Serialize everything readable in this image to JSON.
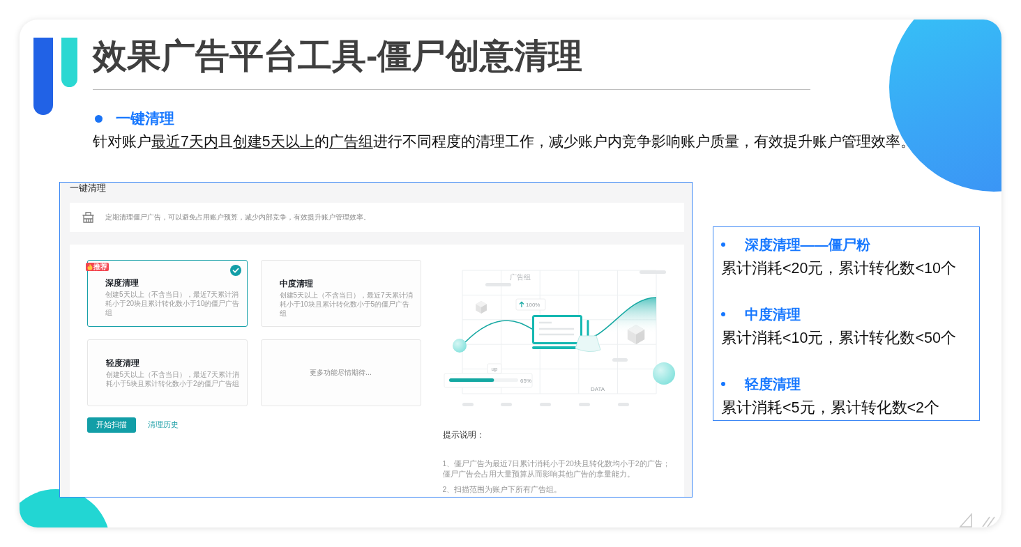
{
  "slide": {
    "title": "效果广告平台工具-僵尸创意清理"
  },
  "section": {
    "heading": "一键清理",
    "description": [
      {
        "text": "针对账户",
        "underlined": false
      },
      {
        "text": "最近7天内",
        "underlined": true
      },
      {
        "text": "且",
        "underlined": false
      },
      {
        "text": "创建5天以上",
        "underlined": true
      },
      {
        "text": "的",
        "underlined": false
      },
      {
        "text": "广告组",
        "underlined": true
      },
      {
        "text": "进行不同程度的清理工作，减少账户内竞争影响账户质量，有效提升账户管理效率。",
        "underlined": false
      }
    ]
  },
  "app": {
    "title": "一键清理",
    "notice": "定期清理僵尸广告，可以避免占用账户预算，减少内部竞争，有效提升账户管理效率。",
    "options": [
      {
        "kind": "mode",
        "title": "深度清理",
        "description": "创建5天以上（不含当日），最近7天累计消耗小于20块且累计转化数小于10的僵尸广告组",
        "badge": "推荐",
        "selected": true
      },
      {
        "kind": "mode",
        "title": "中度清理",
        "description": "创建5天以上（不含当日），最近7天累计消耗小于10块且累计转化数小于5的僵尸广告组",
        "selected": false
      },
      {
        "kind": "mode",
        "title": "轻度清理",
        "description": "创建5天以上（不含当日），最近7天累计消耗小于5块且累计转化数小于2的僵尸广告组",
        "selected": false
      },
      {
        "kind": "placeholder",
        "text": "更多功能尽情期待..."
      }
    ],
    "scan_button": "开始扫描",
    "history_link": "清理历史",
    "illustration": {
      "column_label": "广告组",
      "growth_tag": "100%",
      "progress": {
        "tag": "up",
        "level": 0.65,
        "reading": "65%"
      },
      "axis_label": "DATA"
    },
    "tips": {
      "title": "提示说明：",
      "items": [
        "1、僵尸广告为最近7日累计消耗小于20块且转化数均小于2的广告；僵尸广告会占用大量预算从而影响其他广告的拿量能力。",
        "2、扫描范围为账户下所有广告组。"
      ]
    }
  },
  "levels": [
    {
      "title": "深度清理——僵尸粉",
      "criteria": "累计消耗<20元，累计转化数<10个"
    },
    {
      "title": "中度清理",
      "criteria": "累计消耗<10元，累计转化数<50个"
    },
    {
      "title": "轻度清理",
      "criteria": "累计消耗<5元，累计转化数<2个"
    }
  ]
}
